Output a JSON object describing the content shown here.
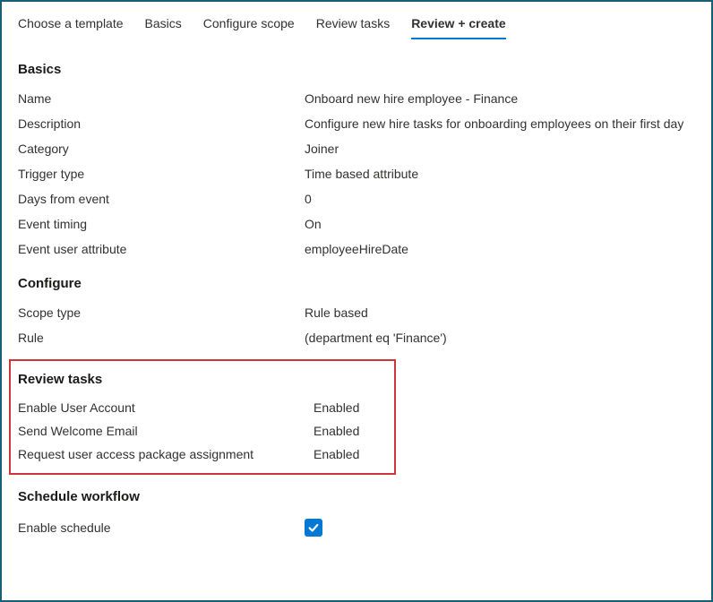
{
  "tabs": [
    {
      "label": "Choose a template"
    },
    {
      "label": "Basics"
    },
    {
      "label": "Configure scope"
    },
    {
      "label": "Review tasks"
    },
    {
      "label": "Review + create"
    }
  ],
  "sections": {
    "basics": {
      "title": "Basics",
      "rows": [
        {
          "label": "Name",
          "value": "Onboard new hire employee - Finance"
        },
        {
          "label": "Description",
          "value": "Configure new hire tasks for onboarding employees on their first day"
        },
        {
          "label": "Category",
          "value": "Joiner"
        },
        {
          "label": "Trigger type",
          "value": "Time based attribute"
        },
        {
          "label": "Days from event",
          "value": "0"
        },
        {
          "label": "Event timing",
          "value": "On"
        },
        {
          "label": "Event user attribute",
          "value": "employeeHireDate"
        }
      ]
    },
    "configure": {
      "title": "Configure",
      "rows": [
        {
          "label": "Scope type",
          "value": "Rule based"
        },
        {
          "label": "Rule",
          "value": " (department eq 'Finance')"
        }
      ]
    },
    "reviewTasks": {
      "title": "Review tasks",
      "rows": [
        {
          "label": "Enable User Account",
          "value": "Enabled"
        },
        {
          "label": "Send Welcome Email",
          "value": "Enabled"
        },
        {
          "label": "Request user access package assignment",
          "value": "Enabled"
        }
      ]
    },
    "schedule": {
      "title": "Schedule workflow",
      "enableLabel": "Enable schedule",
      "enabled": true
    }
  }
}
